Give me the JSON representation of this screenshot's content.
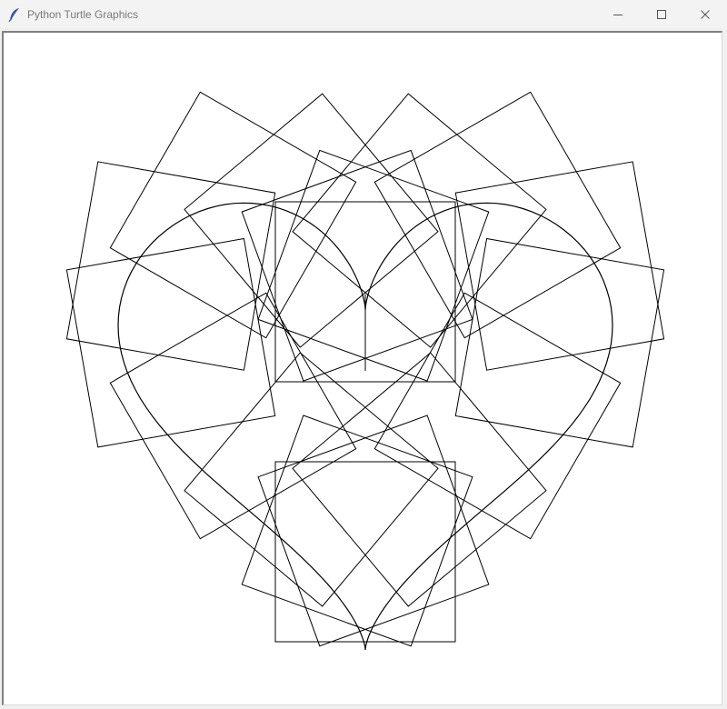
{
  "window": {
    "title": "Python Turtle Graphics",
    "icon": "feather-icon",
    "controls": {
      "minimize_icon": "minimize-icon",
      "maximize_icon": "maximize-icon",
      "close_icon": "close-icon"
    }
  },
  "canvas": {
    "background": "#ffffff",
    "pen_color": "#000000",
    "shape": "square",
    "copies": 18
  }
}
